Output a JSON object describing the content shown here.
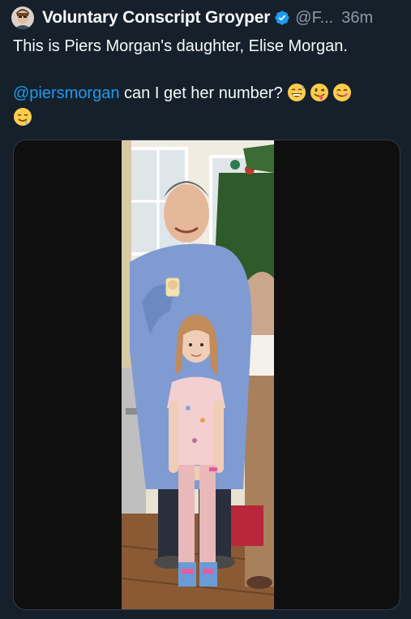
{
  "tweet": {
    "author": {
      "display_name": "Voluntary Conscript Groyper",
      "handle": "@F...",
      "verified_icon": "verified-badge-icon",
      "avatar_icon": "avatar"
    },
    "time": "36m",
    "text_line1": "This is Piers Morgan's daughter, Elise Morgan.",
    "mention": "@piersmorgan",
    "text_line2_rest": " can I get her number?",
    "emojis": [
      "grinning-sweat-emoji",
      "winking-tongue-emoji",
      "yum-emoji",
      "drooling-emoji"
    ],
    "media": {
      "type": "photo",
      "icon": "photo-image"
    }
  },
  "colors": {
    "background": "#15202b",
    "text": "#f7f9f9",
    "muted": "#8b98a5",
    "link": "#1d9bf0",
    "verified": "#1d9bf0"
  }
}
